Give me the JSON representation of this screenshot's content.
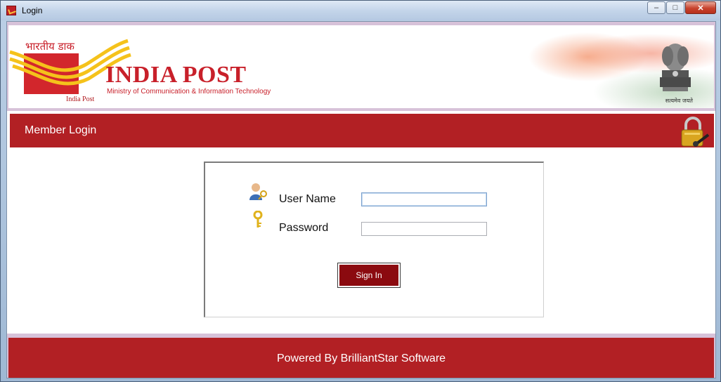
{
  "window": {
    "title": "Login",
    "controls": {
      "minimize": "–",
      "maximize": "□",
      "close": "✕"
    }
  },
  "banner": {
    "hindi_name": "भारतीय डाक",
    "logo_caption": "India Post",
    "title": "INDIA POST",
    "subtitle": "Ministry of Communication & Information Technology",
    "emblem_caption": "सत्यमेव जयते"
  },
  "login_bar": {
    "title": "Member Login",
    "icon": "padlock-icon"
  },
  "form": {
    "username_label": "User Name",
    "username_value": "",
    "username_icon": "user-key-icon",
    "password_label": "Password",
    "password_value": "",
    "password_icon": "key-icon",
    "signin_label": "Sign In"
  },
  "footer": {
    "text": "Powered By BrilliantStar Software"
  },
  "colors": {
    "brand_red": "#b22024",
    "button_red": "#8b0a0f",
    "frame_lilac": "#d7c2d9"
  }
}
